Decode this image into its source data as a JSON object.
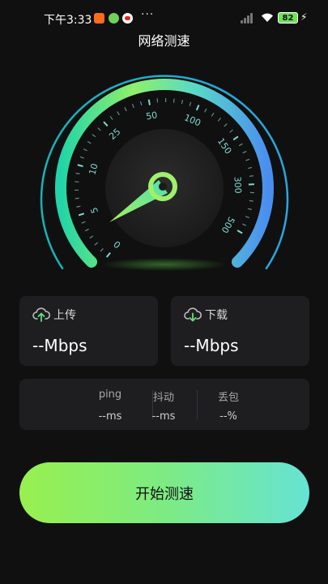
{
  "status_bar": {
    "time": "下午3:33",
    "more": "···",
    "battery": "82",
    "charging": "⚡"
  },
  "page_title": "网络测速",
  "gauge": {
    "ticks": [
      "0",
      "5",
      "10",
      "25",
      "50",
      "100",
      "150",
      "300",
      "500"
    ],
    "needle_value": "0",
    "colors": {
      "start": "#19c9c9",
      "mid": "#8ff06a",
      "end": "#4a8ef0",
      "needle": "#8ff06a"
    }
  },
  "upload": {
    "label": "上传",
    "value": "--Mbps"
  },
  "download": {
    "label": "下载",
    "value": "--Mbps"
  },
  "stats": [
    {
      "label": "ping",
      "value": "--ms"
    },
    {
      "label": "抖动",
      "value": "--ms"
    },
    {
      "label": "丢包",
      "value": "--%"
    }
  ],
  "start_button": {
    "label": "开始测速"
  }
}
